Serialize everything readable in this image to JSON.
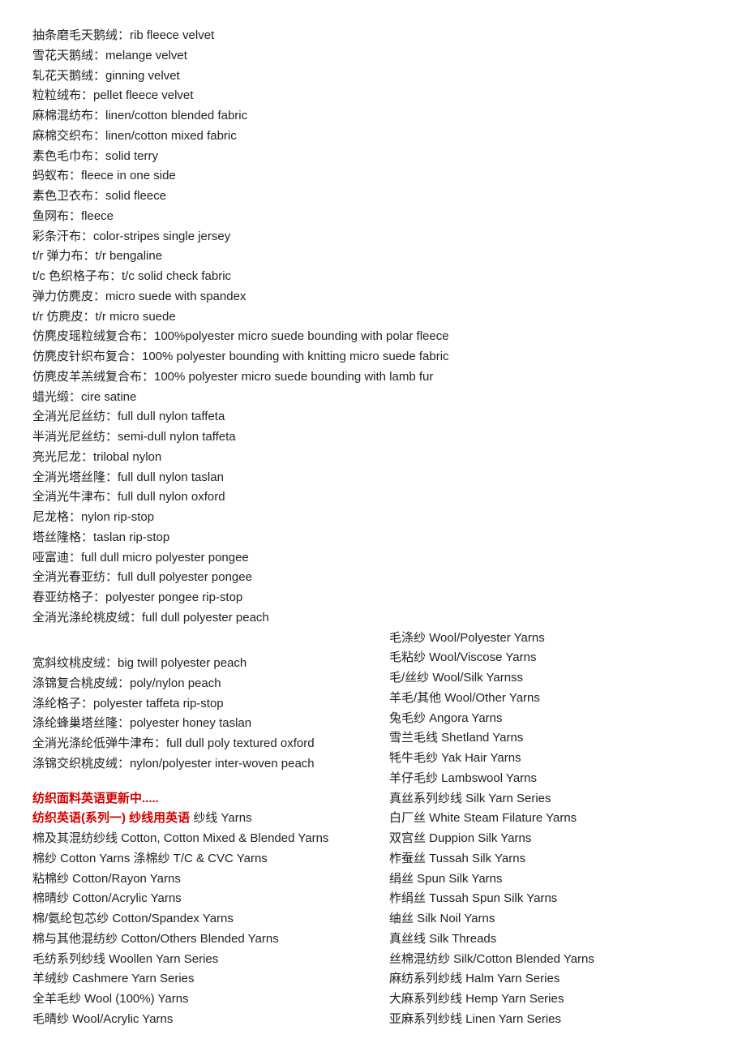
{
  "top_lines": [
    "抽条磨毛天鹅绒：rib fleece velvet",
    "雪花天鹅绒：melange velvet",
    "轧花天鹅绒：ginning velvet",
    "粒粒绒布：pellet fleece velvet",
    "麻棉混纺布：linen/cotton blended fabric",
    "麻棉交织布：linen/cotton mixed fabric",
    "素色毛巾布：solid terry",
    "蚂蚁布：fleece in one side",
    "素色卫衣布：solid fleece",
    "鱼网布：fleece",
    "彩条汗布：color-stripes single jersey",
    "t/r 弹力布：t/r bengaline",
    "t/c 色织格子布：t/c solid check fabric",
    "弹力仿麂皮：micro suede with spandex",
    "t/r 仿麂皮：t/r micro suede",
    "仿麂皮瑶粒绒复合布：100%polyester micro suede bounding with polar fleece",
    "仿麂皮针织布复合：100% polyester bounding with knitting micro suede fabric",
    "仿麂皮羊羔绒复合布：100% polyester micro suede bounding with lamb fur",
    "蜡光缎：cire satine",
    "全消光尼丝纺：full dull nylon taffeta",
    "半消光尼丝纺：semi-dull nylon taffeta",
    "亮光尼龙：trilobal nylon",
    "全消光塔丝隆：full dull nylon taslan",
    "全消光牛津布：full dull nylon oxford",
    "尼龙格：nylon rip-stop",
    "塔丝隆格：taslan rip-stop",
    "哑富迪：full dull micro polyester pongee",
    "全消光春亚纺：full dull polyester pongee",
    "春亚纺格子：polyester pongee rip-stop",
    "全消光涤纶桃皮绒：full dull polyester peach"
  ],
  "left_tail": [
    "宽斜纹桃皮绒：big twill polyester peach",
    "涤锦复合桃皮绒：poly/nylon peach",
    "涤纶格子：polyester taffeta rip-stop",
    "涤纶蜂巢塔丝隆：polyester honey taslan",
    "全消光涤纶低弹牛津布：full dull poly textured oxford",
    "涤锦交织桃皮绒：nylon/polyester inter-woven peach"
  ],
  "heading_update": "纺织面料英语更新中.....",
  "heading_series_red": "纺织英语(系列一) 纱线用英语",
  "heading_series_black": " 纱线 Yarns",
  "left_bottom": [
    "棉及其混纺纱线  Cotton, Cotton Mixed & Blended Yarns",
    "棉纱 Cotton Yarns  涤棉纱 T/C & CVC Yarns",
    "粘棉纱 Cotton/Rayon Yarns",
    "棉晴纱 Cotton/Acrylic Yarns",
    "棉/氨纶包芯纱 Cotton/Spandex Yarns",
    "棉与其他混纺纱 Cotton/Others Blended Yarns",
    "毛纺系列纱线 Woollen Yarn Series",
    "羊绒纱 Cashmere Yarn Series",
    "全羊毛纱 Wool (100%) Yarns",
    "毛晴纱 Wool/Acrylic Yarns"
  ],
  "right_col": [
    "毛涤纱 Wool/Polyester Yarns",
    "毛粘纱 Wool/Viscose Yarns",
    "毛/丝纱 Wool/Silk Yarnss",
    "羊毛/其他 Wool/Other Yarns",
    "兔毛纱 Angora Yarns",
    "雪兰毛线 Shetland Yarns",
    "牦牛毛纱 Yak Hair Yarns",
    "羊仔毛纱 Lambswool Yarns",
    "真丝系列纱线 Silk Yarn Series",
    "白厂丝 White Steam Filature Yarns",
    "双宫丝 Duppion Silk Yarns",
    "柞蚕丝 Tussah Silk Yarns",
    "绢丝 Spun Silk Yarns",
    "柞绢丝 Tussah Spun Silk Yarns",
    "䌷丝 Silk Noil Yarns",
    "真丝线 Silk Threads",
    "丝棉混纺纱 Silk/Cotton Blended Yarns",
    "麻纺系列纱线 Halm Yarn Series",
    "大麻系列纱线 Hemp Yarn Series",
    "亚麻系列纱线 Linen Yarn Series"
  ]
}
